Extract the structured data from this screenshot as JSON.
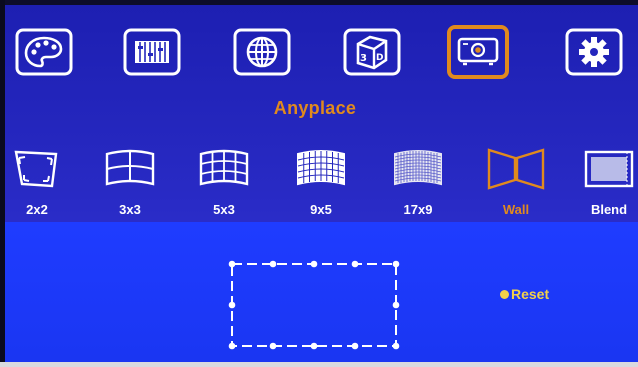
{
  "menu": {
    "items": [
      {
        "icon": "palette-icon"
      },
      {
        "icon": "adjust-sliders-icon"
      },
      {
        "icon": "globe-icon"
      },
      {
        "icon": "3d-cube-icon"
      },
      {
        "icon": "projector-icon",
        "selected": true
      },
      {
        "icon": "gear-icon"
      }
    ],
    "selected_color": "#e08a1e"
  },
  "section_title": "Anyplace",
  "modes": [
    {
      "label": "2x2",
      "icon": "corner-warp-icon"
    },
    {
      "label": "3x3",
      "icon": "grid-3x3-icon"
    },
    {
      "label": "5x3",
      "icon": "grid-5x3-icon"
    },
    {
      "label": "9x5",
      "icon": "grid-9x5-icon"
    },
    {
      "label": "17x9",
      "icon": "grid-17x9-icon"
    },
    {
      "label": "Wall",
      "icon": "wall-icon",
      "selected": true
    },
    {
      "label": "Blend",
      "icon": "blend-icon"
    }
  ],
  "reset": {
    "label": "Reset"
  },
  "colors": {
    "accent": "#e08a1e",
    "reset": "#f2d14a",
    "top_bg": "#2426bd",
    "bottom_bg": "#1f3cff"
  }
}
